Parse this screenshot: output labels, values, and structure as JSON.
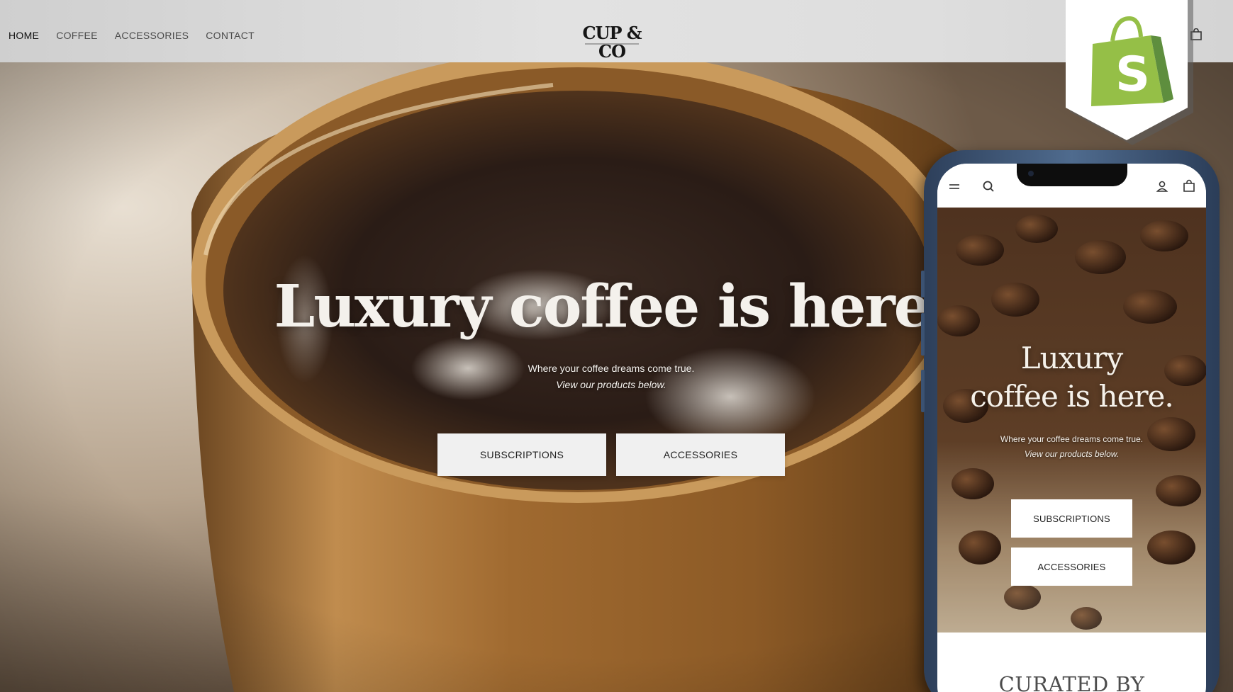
{
  "desktop": {
    "nav": {
      "items": [
        {
          "label": "HOME",
          "active": true
        },
        {
          "label": "COFFEE",
          "active": false
        },
        {
          "label": "ACCESSORIES",
          "active": false
        },
        {
          "label": "CONTACT",
          "active": false
        }
      ]
    },
    "logo_text": "CUP & CO",
    "cart_icon": "shopping-bag-icon",
    "hero": {
      "title": "Luxury coffee is here.",
      "subtitle_line1": "Where your coffee dreams come true.",
      "subtitle_line2": "View our products below.",
      "buttons": {
        "subscriptions": "SUBSCRIPTIONS",
        "accessories": "ACCESSORIES"
      }
    }
  },
  "badge": {
    "icon": "shopify-logo-icon",
    "colors": {
      "green": "#95bf47",
      "dark_green": "#5e8e3e",
      "white": "#ffffff"
    }
  },
  "mobile": {
    "header_icons": [
      "menu-icon",
      "search-icon",
      "account-icon",
      "shopping-bag-icon"
    ],
    "hero": {
      "title_line1": "Luxury",
      "title_line2": "coffee is here.",
      "subtitle_line1": "Where your coffee dreams come true.",
      "subtitle_line2": "View our products below.",
      "buttons": {
        "subscriptions": "SUBSCRIPTIONS",
        "accessories": "ACCESSORIES"
      }
    },
    "section_heading": "CURATED BY"
  },
  "colors": {
    "topbar": "#e0e0e0",
    "button_bg": "#f0f0f0",
    "phone_frame": "#3e5678",
    "coffee_cup": "#a8773c"
  }
}
